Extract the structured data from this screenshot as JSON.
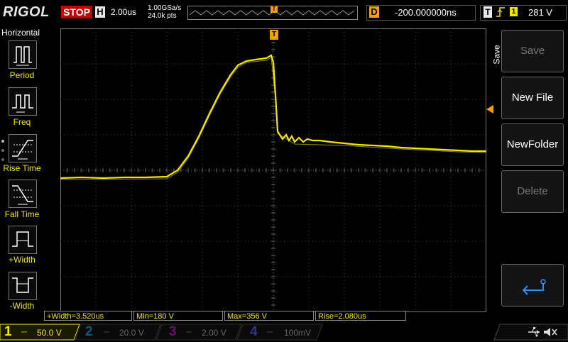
{
  "header": {
    "brand": "RIGOL",
    "run_state": "STOP",
    "timebase_letter": "H",
    "timebase": "2.00us",
    "sample_rate": "1.00GSa/s",
    "points": "24.0k pts",
    "trigger_marker": "T",
    "delay_letter": "D",
    "delay": "-200.000000ns",
    "trigger_letter": "T",
    "trigger_source": "1",
    "trigger_level": "281 V"
  },
  "left_menu": {
    "title": "Horizontal",
    "items": [
      {
        "label": "Period",
        "icon": "period-icon"
      },
      {
        "label": "Freq",
        "icon": "frequency-icon"
      },
      {
        "label": "Rise Time",
        "icon": "rise-time-icon"
      },
      {
        "label": "Fall Time",
        "icon": "fall-time-icon"
      },
      {
        "label": "+Width",
        "icon": "positive-width-icon"
      },
      {
        "label": "-Width",
        "icon": "negative-width-icon"
      }
    ]
  },
  "right_menu": {
    "title": "Save",
    "buttons": [
      {
        "label": "Save",
        "enabled": false
      },
      {
        "label": "New File",
        "enabled": true
      },
      {
        "label": "NewFolder",
        "enabled": true
      },
      {
        "label": "Delete",
        "enabled": false
      },
      {
        "label": "",
        "icon": "return-arrow-icon",
        "enabled": true
      }
    ]
  },
  "measurements": [
    {
      "label": "+Width=3.520us"
    },
    {
      "label": "Min=180 V"
    },
    {
      "label": "Max=356 V"
    },
    {
      "label": "Rise=2.080us"
    }
  ],
  "channels": [
    {
      "num": "1",
      "scale": "50.0 V",
      "active": true,
      "color": "#f2e600"
    },
    {
      "num": "2",
      "scale": "20.0 V",
      "active": false,
      "color": "#00a0c8"
    },
    {
      "num": "3",
      "scale": "2.00 V",
      "active": false,
      "color": "#c000c0"
    },
    {
      "num": "4",
      "scale": "100mV",
      "active": false,
      "color": "#3060ff"
    }
  ],
  "status_icons": [
    "usb-icon",
    "speaker-muted-icon"
  ],
  "colors": {
    "ch1": "#f2e600",
    "stop": "#c00000",
    "delay": "#f2a100",
    "grid": "#555555"
  }
}
